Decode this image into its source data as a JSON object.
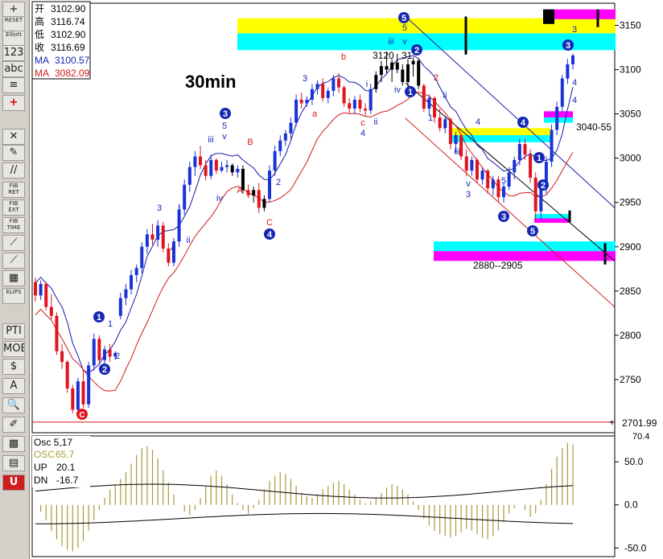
{
  "toolbar": {
    "items": [
      {
        "name": "zoom-in-icon",
        "label": "+"
      },
      {
        "name": "reset-icon",
        "label": "RESET"
      },
      {
        "name": "elliott-icon",
        "label": "Elliott"
      },
      {
        "name": "wave-labels-icon",
        "label": "123"
      },
      {
        "name": "wave-labels-alt-icon",
        "label": "abc"
      },
      {
        "name": "align-icon",
        "label": "≡"
      },
      {
        "name": "crosshair-icon",
        "label": "+"
      },
      {
        "name": "delete-icon",
        "label": "✕"
      },
      {
        "name": "pencil-icon",
        "label": "✎"
      },
      {
        "name": "channel-icon",
        "label": "//"
      },
      {
        "name": "fib-ret-icon",
        "label": "FIB RET"
      },
      {
        "name": "fib-ext-icon",
        "label": "FIB EXT"
      },
      {
        "name": "fib-time-icon",
        "label": "FIB TIME"
      },
      {
        "name": "fan-icon",
        "label": "⟋"
      },
      {
        "name": "gann-icon",
        "label": "⟋"
      },
      {
        "name": "grid-icon",
        "label": "▦"
      },
      {
        "name": "elips-icon",
        "label": "ELIPS"
      },
      {
        "name": "pti-icon",
        "label": "PTI"
      },
      {
        "name": "mob-icon",
        "label": "MOB"
      },
      {
        "name": "dollar-icon",
        "label": "$"
      },
      {
        "name": "text-icon",
        "label": "A"
      },
      {
        "name": "magnifier-icon",
        "label": "🔍"
      },
      {
        "name": "brush-icon",
        "label": "✐"
      },
      {
        "name": "checker-icon",
        "label": "▩"
      },
      {
        "name": "notes-icon",
        "label": "▤"
      },
      {
        "name": "unit-icon",
        "label": "U"
      }
    ]
  },
  "info": {
    "open_label": "开",
    "open": "3102.90",
    "high_label": "高",
    "high": "3116.74",
    "low_label": "低",
    "low": "3102.90",
    "close_label": "收",
    "close": "3116.69",
    "ma1_label": "MA",
    "ma1": "3100.57",
    "ma2_label": "MA",
    "ma2": "3082.09"
  },
  "timeframe": "30min",
  "last_price": "2701.99",
  "annotations": {
    "range_low": "2880--2905",
    "range_mid": "3040-55",
    "peak": "3120",
    "peak_suffix": "31"
  },
  "oscillator": {
    "title": "Osc 5,17",
    "osc_label": "OSC",
    "osc_value": "65.7",
    "up_label": "UP",
    "up_value": "20.1",
    "dn_label": "DN",
    "dn_value": "-16.7",
    "corner_value": "70.4"
  },
  "colors": {
    "up_bar": "#1a33d6",
    "down_bar": "#e0141e",
    "neutral_bar": "#000000",
    "ma_fast": "#1a1aa8",
    "ma_slow": "#d01a1a",
    "osc": "#a89a3a",
    "yellow": "#ffff00",
    "cyan": "#00ffff",
    "magenta": "#ff00ff"
  },
  "chart_data": {
    "type": "candlestick",
    "ylim": [
      2690,
      3175
    ],
    "y_ticks": [
      2750,
      2800,
      2850,
      2900,
      2950,
      3000,
      3050,
      3100,
      3150
    ],
    "bars": [
      [
        2860,
        2865,
        2838,
        2845
      ],
      [
        2845,
        2862,
        2840,
        2858
      ],
      [
        2858,
        2860,
        2828,
        2832
      ],
      [
        2832,
        2846,
        2818,
        2822
      ],
      [
        2822,
        2826,
        2778,
        2782
      ],
      [
        2782,
        2790,
        2762,
        2770
      ],
      [
        2770,
        2772,
        2735,
        2740
      ],
      [
        2740,
        2744,
        2712,
        2716
      ],
      [
        2716,
        2752,
        2712,
        2748
      ],
      [
        2748,
        2760,
        2718,
        2722
      ],
      [
        2722,
        2770,
        2718,
        2766
      ],
      [
        2766,
        2802,
        2760,
        2796
      ],
      [
        2796,
        2800,
        2768,
        2772
      ],
      [
        2772,
        2788,
        2766,
        2784
      ],
      [
        2784,
        2790,
        2770,
        2776
      ],
      [
        2776,
        2782,
        2772,
        2780
      ],
      [
        2822,
        2848,
        2818,
        2842
      ],
      [
        2842,
        2858,
        2834,
        2852
      ],
      [
        2852,
        2874,
        2846,
        2868
      ],
      [
        2868,
        2880,
        2860,
        2876
      ],
      [
        2876,
        2905,
        2870,
        2900
      ],
      [
        2900,
        2920,
        2892,
        2914
      ],
      [
        2914,
        2926,
        2902,
        2908
      ],
      [
        2908,
        2930,
        2900,
        2924
      ],
      [
        2924,
        2928,
        2894,
        2898
      ],
      [
        2898,
        2904,
        2878,
        2882
      ],
      [
        2882,
        2910,
        2878,
        2906
      ],
      [
        2906,
        2948,
        2900,
        2942
      ],
      [
        2942,
        2976,
        2936,
        2970
      ],
      [
        2970,
        2996,
        2962,
        2990
      ],
      [
        2990,
        3008,
        2980,
        3002
      ],
      [
        3002,
        3014,
        2988,
        2992
      ],
      [
        2992,
        2998,
        2975,
        2980
      ],
      [
        2980,
        3004,
        2976,
        2998
      ],
      [
        2998,
        3000,
        2982,
        2986
      ],
      [
        2986,
        2996,
        2984,
        2990
      ],
      [
        2990,
        2998,
        2984,
        2992
      ],
      [
        2992,
        2994,
        2980,
        2984
      ],
      [
        2984,
        2992,
        2978,
        2988
      ],
      [
        2988,
        2992,
        2960,
        2964
      ],
      [
        2964,
        2970,
        2955,
        2958
      ],
      [
        2958,
        2968,
        2950,
        2964
      ],
      [
        2964,
        2972,
        2938,
        2944
      ],
      [
        2944,
        2958,
        2940,
        2954
      ],
      [
        2954,
        2992,
        2950,
        2986
      ],
      [
        2986,
        3014,
        2980,
        3008
      ],
      [
        3008,
        3026,
        3002,
        3020
      ],
      [
        3020,
        3032,
        3014,
        3028
      ],
      [
        3028,
        3046,
        3022,
        3040
      ],
      [
        3040,
        3072,
        3036,
        3066
      ],
      [
        3066,
        3074,
        3056,
        3062
      ],
      [
        3062,
        3070,
        3058,
        3066
      ],
      [
        3066,
        3084,
        3060,
        3078
      ],
      [
        3078,
        3088,
        3072,
        3084
      ],
      [
        3084,
        3090,
        3064,
        3068
      ],
      [
        3068,
        3080,
        3062,
        3076
      ],
      [
        3076,
        3094,
        3070,
        3090
      ],
      [
        3090,
        3096,
        3074,
        3080
      ],
      [
        3080,
        3082,
        3058,
        3062
      ],
      [
        3062,
        3068,
        3050,
        3056
      ],
      [
        3056,
        3070,
        3050,
        3066
      ],
      [
        3066,
        3072,
        3052,
        3056
      ],
      [
        3056,
        3062,
        3048,
        3054
      ],
      [
        3054,
        3084,
        3050,
        3078
      ],
      [
        3078,
        3098,
        3074,
        3094
      ],
      [
        3094,
        3110,
        3086,
        3104
      ],
      [
        3104,
        3120,
        3096,
        3100
      ],
      [
        3100,
        3112,
        3086,
        3108
      ],
      [
        3108,
        3118,
        3096,
        3100
      ],
      [
        3100,
        3106,
        3082,
        3086
      ],
      [
        3086,
        3112,
        3080,
        3106
      ],
      [
        3106,
        3114,
        3092,
        3110
      ],
      [
        3110,
        3112,
        3078,
        3082
      ],
      [
        3082,
        3084,
        3052,
        3056
      ],
      [
        3056,
        3072,
        3048,
        3068
      ],
      [
        3068,
        3070,
        3040,
        3046
      ],
      [
        3046,
        3056,
        3030,
        3034
      ],
      [
        3034,
        3048,
        3028,
        3044
      ],
      [
        3044,
        3046,
        3010,
        3016
      ],
      [
        3016,
        3030,
        3006,
        3026
      ],
      [
        3026,
        3028,
        2998,
        3002
      ],
      [
        3002,
        3010,
        2980,
        2986
      ],
      [
        2986,
        3002,
        2980,
        2998
      ],
      [
        2998,
        3000,
        2972,
        2976
      ],
      [
        2976,
        2990,
        2970,
        2986
      ],
      [
        2986,
        2988,
        2960,
        2966
      ],
      [
        2966,
        2980,
        2958,
        2976
      ],
      [
        2976,
        2980,
        2950,
        2956
      ],
      [
        2956,
        2972,
        2950,
        2968
      ],
      [
        2968,
        2990,
        2964,
        2984
      ],
      [
        2984,
        3002,
        2976,
        2998
      ],
      [
        2998,
        3022,
        2992,
        3016
      ],
      [
        3016,
        3022,
        2998,
        3004
      ],
      [
        3004,
        3010,
        2972,
        2978
      ],
      [
        2978,
        2984,
        2930,
        2940
      ],
      [
        2940,
        2972,
        2930,
        2966
      ],
      [
        2966,
        3002,
        2960,
        2996
      ],
      [
        2996,
        3038,
        2990,
        3032
      ],
      [
        3032,
        3064,
        3026,
        3058
      ],
      [
        3058,
        3094,
        3052,
        3090
      ],
      [
        3090,
        3112,
        3084,
        3106
      ],
      [
        3106,
        3118,
        3100,
        3116
      ]
    ],
    "osc": [
      0,
      -8,
      -18,
      -30,
      -40,
      -48,
      -52,
      -54,
      -50,
      -42,
      -30,
      -18,
      -6,
      8,
      18,
      24,
      30,
      38,
      48,
      58,
      66,
      68,
      64,
      54,
      40,
      26,
      12,
      0,
      -8,
      -12,
      -6,
      8,
      22,
      34,
      40,
      34,
      24,
      12,
      2,
      -6,
      -10,
      -4,
      6,
      18,
      28,
      34,
      38,
      36,
      30,
      22,
      14,
      10,
      8,
      12,
      18,
      22,
      26,
      28,
      24,
      18,
      12,
      6,
      2,
      4,
      8,
      14,
      20,
      24,
      22,
      18,
      12,
      4,
      -6,
      -16,
      -24,
      -30,
      -34,
      -36,
      -38,
      -36,
      -32,
      -28,
      -30,
      -34,
      -38,
      -40,
      -36,
      -30,
      -20,
      -10,
      -4,
      0,
      -6,
      -14,
      -10,
      6,
      24,
      42,
      56,
      66,
      72,
      70
    ]
  }
}
